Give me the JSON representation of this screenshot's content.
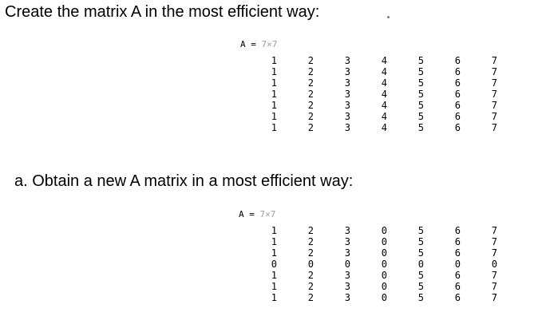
{
  "heading_1": "Create the matrix A in the most efficient way:",
  "heading_2": "a.  Obtain a new A matrix in a most efficient way:",
  "matrix_1": {
    "var_label": "A =",
    "size_label": "7×7",
    "rows": [
      [
        "1",
        "2",
        "3",
        "4",
        "5",
        "6",
        "7"
      ],
      [
        "1",
        "2",
        "3",
        "4",
        "5",
        "6",
        "7"
      ],
      [
        "1",
        "2",
        "3",
        "4",
        "5",
        "6",
        "7"
      ],
      [
        "1",
        "2",
        "3",
        "4",
        "5",
        "6",
        "7"
      ],
      [
        "1",
        "2",
        "3",
        "4",
        "5",
        "6",
        "7"
      ],
      [
        "1",
        "2",
        "3",
        "4",
        "5",
        "6",
        "7"
      ],
      [
        "1",
        "2",
        "3",
        "4",
        "5",
        "6",
        "7"
      ]
    ]
  },
  "matrix_2": {
    "var_label": "A =",
    "size_label": "7×7",
    "rows": [
      [
        "1",
        "2",
        "3",
        "0",
        "5",
        "6",
        "7"
      ],
      [
        "1",
        "2",
        "3",
        "0",
        "5",
        "6",
        "7"
      ],
      [
        "1",
        "2",
        "3",
        "0",
        "5",
        "6",
        "7"
      ],
      [
        "0",
        "0",
        "0",
        "0",
        "0",
        "0",
        "0"
      ],
      [
        "1",
        "2",
        "3",
        "0",
        "5",
        "6",
        "7"
      ],
      [
        "1",
        "2",
        "3",
        "0",
        "5",
        "6",
        "7"
      ],
      [
        "1",
        "2",
        "3",
        "0",
        "5",
        "6",
        "7"
      ]
    ]
  }
}
